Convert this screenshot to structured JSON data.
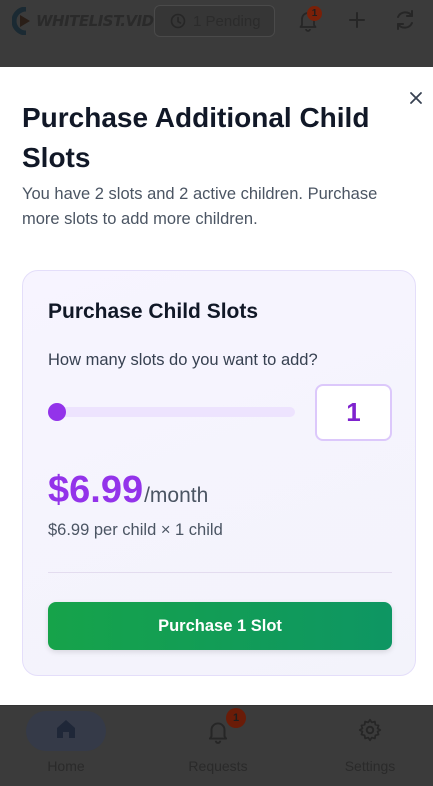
{
  "header": {
    "logo_text": "WHITELIST.VIDEO",
    "pending_label": "1 Pending",
    "notification_count": "1"
  },
  "modal": {
    "title": "Purchase Additional Child Slots",
    "subtitle": "You have 2 slots and 2 active children. Purchase more slots to add more children.",
    "close_label": "×",
    "card": {
      "title": "Purchase Child Slots",
      "question": "How many slots do you want to add?",
      "slider": {
        "min": 1,
        "max": 10,
        "value": 1
      },
      "quantity": "1",
      "price": "$6.99",
      "per": "/month",
      "breakdown": "$6.99 per child × 1 child",
      "button_label": "Purchase 1 Slot"
    }
  },
  "bottom_nav": {
    "items": [
      {
        "label": "Home",
        "icon": "home-icon",
        "active": true
      },
      {
        "label": "Requests",
        "icon": "bell-icon",
        "badge": "1"
      },
      {
        "label": "Settings",
        "icon": "gear-icon"
      }
    ]
  },
  "colors": {
    "accent": "#9333ea",
    "button": "#16a34a",
    "overlay": "#3a3a3a"
  }
}
